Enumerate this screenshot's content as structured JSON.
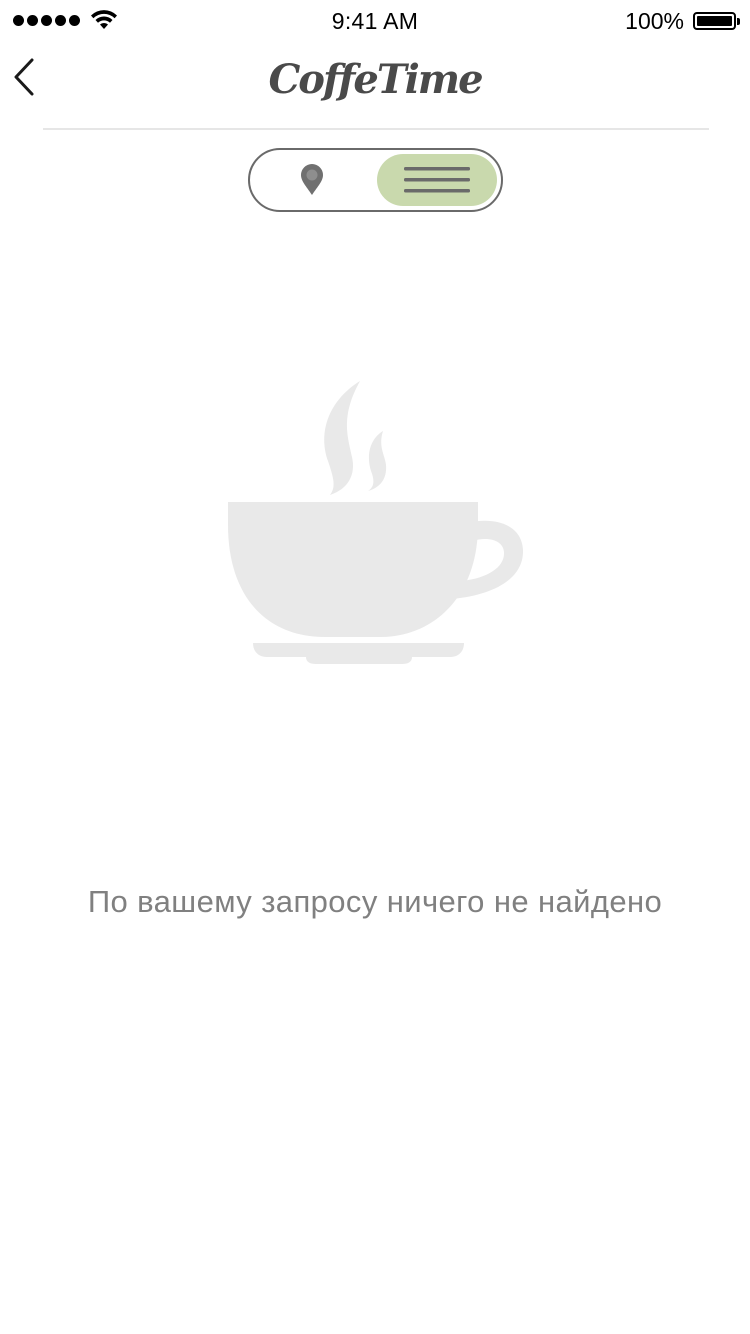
{
  "status_bar": {
    "time": "9:41 AM",
    "battery_percent": "100%",
    "battery_level": 1.0,
    "signal_bars": 5
  },
  "nav": {
    "title": "CoffeTime",
    "back_icon": "chevron-left-icon"
  },
  "view_toggle": {
    "options": [
      {
        "id": "map",
        "icon": "map-pin-icon",
        "selected": false
      },
      {
        "id": "list",
        "icon": "menu-lines-icon",
        "selected": true
      }
    ],
    "selected_color": "#c9d9ad",
    "icon_color": "#6a6a6a"
  },
  "empty_state": {
    "illustration": "coffee-cup-icon",
    "illustration_color": "#e9e9e9",
    "message": "По вашему запросу ничего не найдено"
  }
}
